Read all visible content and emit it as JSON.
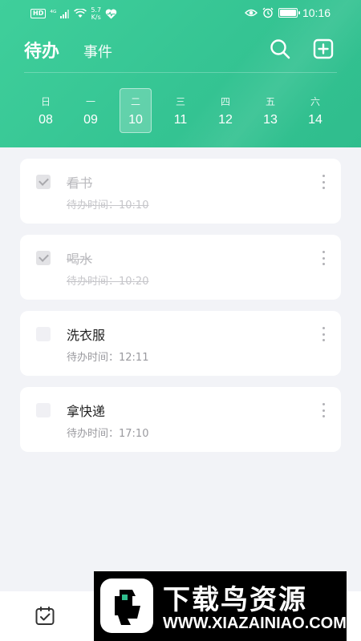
{
  "status_bar": {
    "hd": "HD",
    "signal": "⁴ᴳ",
    "net_speed_value": "5.7",
    "net_speed_unit": "K/s",
    "time": "10:16"
  },
  "header": {
    "tab_todo": "待办",
    "tab_events": "事件"
  },
  "week": [
    {
      "name": "日",
      "num": "08",
      "selected": false
    },
    {
      "name": "一",
      "num": "09",
      "selected": false
    },
    {
      "name": "二",
      "num": "10",
      "selected": true
    },
    {
      "name": "三",
      "num": "11",
      "selected": false
    },
    {
      "name": "四",
      "num": "12",
      "selected": false
    },
    {
      "name": "五",
      "num": "13",
      "selected": false
    },
    {
      "name": "六",
      "num": "14",
      "selected": false
    }
  ],
  "todos": [
    {
      "title": "看书",
      "time": "待办时间：10:10",
      "done": true
    },
    {
      "title": "喝水",
      "time": "待办时间：10:20",
      "done": true
    },
    {
      "title": "洗衣服",
      "time": "待办时间：12:11",
      "done": false
    },
    {
      "title": "拿快递",
      "time": "待办时间：17:10",
      "done": false
    }
  ],
  "watermark": {
    "title": "下载鸟资源",
    "url": "WWW.XIAZAINIAO.COM"
  },
  "colors": {
    "accent": "#35c493",
    "background": "#f2f3f7"
  },
  "icons": {
    "search": "search-icon",
    "add": "add-square-icon",
    "todo_nav": "calendar-check-icon"
  }
}
